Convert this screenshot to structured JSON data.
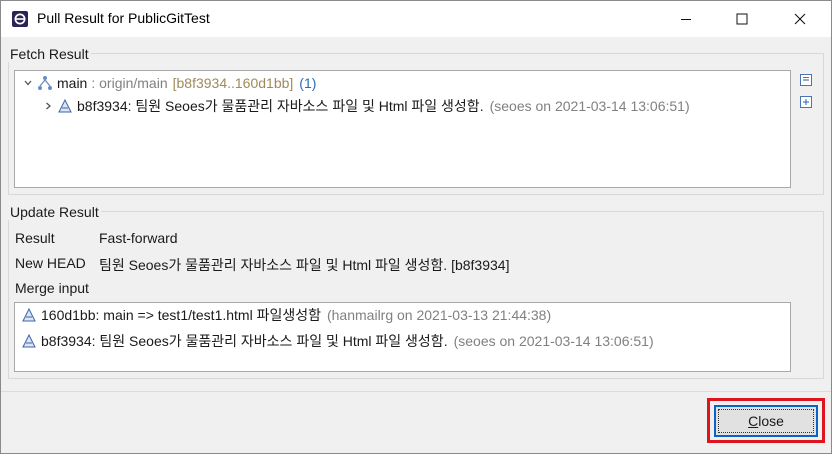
{
  "window": {
    "title": "Pull Result for PublicGitTest"
  },
  "fetch": {
    "group_label": "Fetch Result",
    "branch": {
      "name": "main",
      "tracking": ": origin/main",
      "range": "[b8f3934..160d1bb]",
      "count": "(1)"
    },
    "commit": {
      "text": "b8f3934: 팀원 Seoes가 물품관리 자바소스 파일 및 Html 파일 생성함.",
      "meta": "(seoes on 2021-03-14 13:06:51)"
    }
  },
  "update": {
    "group_label": "Update Result",
    "result_label": "Result",
    "result_value": "Fast-forward",
    "new_head_label": "New HEAD",
    "new_head_value": "팀원 Seoes가 물품관리 자바소스 파일 및 Html 파일 생성함. [b8f3934]",
    "merge_input_label": "Merge input",
    "merge_items": [
      {
        "text": "160d1bb: main => test1/test1.html 파일생성함",
        "meta": "(hanmailrg on 2021-03-13 21:44:38)"
      },
      {
        "text": "b8f3934: 팀원 Seoes가 물품관리 자바소스 파일 및 Html 파일 생성함.",
        "meta": "(seoes on 2021-03-14 13:06:51)"
      }
    ]
  },
  "buttons": {
    "close_first": "C",
    "close_rest": "lose"
  },
  "colors": {
    "highlight": "#e0141e",
    "accent": "#0a64c8"
  }
}
